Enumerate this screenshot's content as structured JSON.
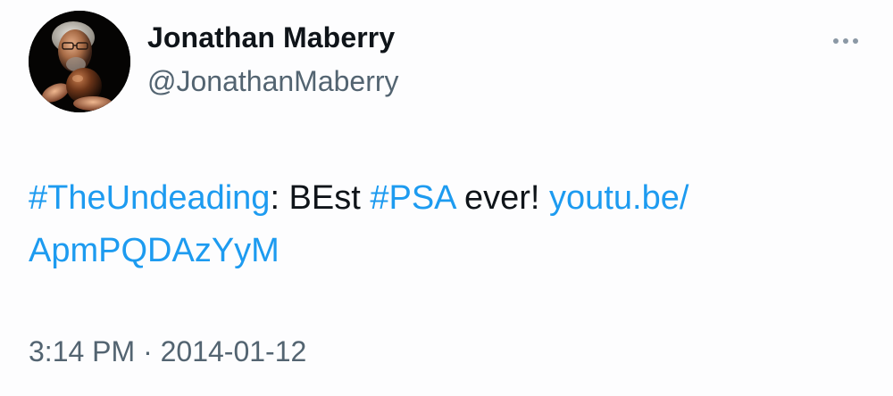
{
  "author": {
    "display_name": "Jonathan Maberry",
    "handle": "@JonathanMaberry",
    "avatar_icon": "profile-photo"
  },
  "more_icon": "ellipsis-horizontal-icon",
  "tweet": {
    "hashtag_1": "#TheUndeading",
    "text_1": ": BEst ",
    "hashtag_2": "#PSA",
    "text_2": " ever! ",
    "link_line_1": "youtu.be/",
    "link_line_2": "ApmPQDAzYyM"
  },
  "meta": {
    "time": "3:14 PM",
    "separator": " · ",
    "date": "2014-01-12"
  },
  "colors": {
    "link": "#1d9bf0",
    "text": "#0f1419",
    "secondary": "#536471",
    "background": "#fdfdfe"
  }
}
